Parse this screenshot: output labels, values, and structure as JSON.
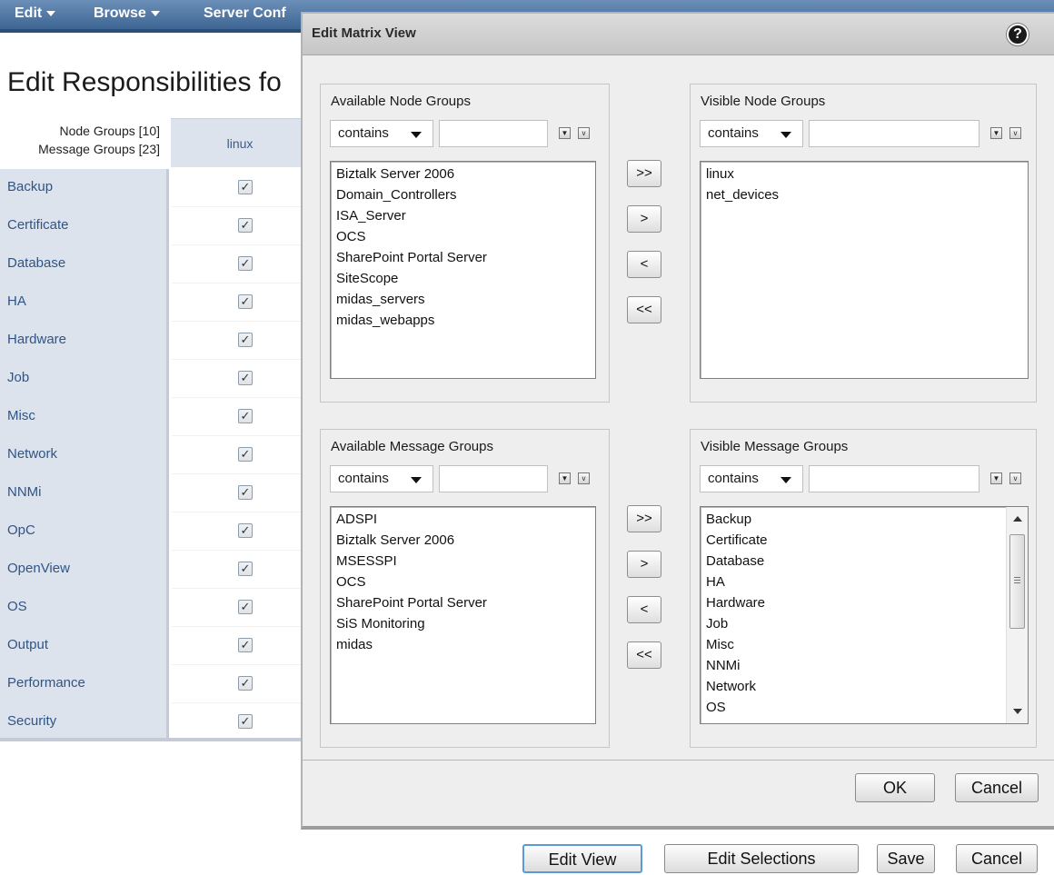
{
  "menubar": {
    "items": [
      {
        "label": "Edit",
        "has_caret": true
      },
      {
        "label": "Browse",
        "has_caret": true
      },
      {
        "label": "Server Conf",
        "has_caret": false
      }
    ]
  },
  "page": {
    "title": "Edit Responsibilities fo"
  },
  "matrix": {
    "node_groups_label": "Node Groups [10]",
    "message_groups_label": "Message Groups [23]",
    "column_header": "linux",
    "rows": [
      {
        "label": "Backup",
        "checked": true
      },
      {
        "label": "Certificate",
        "checked": true
      },
      {
        "label": "Database",
        "checked": true
      },
      {
        "label": "HA",
        "checked": true
      },
      {
        "label": "Hardware",
        "checked": true
      },
      {
        "label": "Job",
        "checked": true
      },
      {
        "label": "Misc",
        "checked": true
      },
      {
        "label": "Network",
        "checked": true
      },
      {
        "label": "NNMi",
        "checked": true
      },
      {
        "label": "OpC",
        "checked": true
      },
      {
        "label": "OpenView",
        "checked": true
      },
      {
        "label": "OS",
        "checked": true
      },
      {
        "label": "Output",
        "checked": true
      },
      {
        "label": "Performance",
        "checked": true
      },
      {
        "label": "Security",
        "checked": true
      }
    ],
    "check_glyph": "✓"
  },
  "page_buttons": {
    "edit_view": "Edit View",
    "edit_selections": "Edit Selections",
    "save": "Save",
    "cancel": "Cancel"
  },
  "dialog": {
    "title": "Edit Matrix View",
    "help_icon": "?",
    "filter_mode": "contains",
    "filter_btn_down": "▼",
    "filter_btn_check": "v",
    "available_node_groups": {
      "title": "Available Node Groups",
      "items": [
        "Biztalk Server 2006",
        "Domain_Controllers",
        "ISA_Server",
        "OCS",
        "SharePoint Portal Server",
        "SiteScope",
        "midas_servers",
        "midas_webapps"
      ]
    },
    "visible_node_groups": {
      "title": "Visible Node Groups",
      "items": [
        "linux",
        "net_devices"
      ]
    },
    "available_message_groups": {
      "title": "Available Message Groups",
      "items": [
        "ADSPI",
        "Biztalk Server 2006",
        "MSESSPI",
        "OCS",
        "SharePoint Portal Server",
        "SiS Monitoring",
        "midas"
      ]
    },
    "visible_message_groups": {
      "title": "Visible Message Groups",
      "items": [
        "Backup",
        "Certificate",
        "Database",
        "HA",
        "Hardware",
        "Job",
        "Misc",
        "NNMi",
        "Network",
        "OS"
      ]
    },
    "move_buttons": {
      "add_all": ">>",
      "add": ">",
      "remove": "<",
      "remove_all": "<<"
    },
    "ok": "OK",
    "cancel": "Cancel"
  }
}
